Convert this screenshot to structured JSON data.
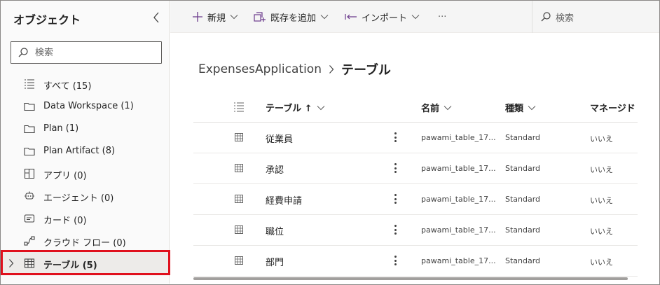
{
  "sidebar": {
    "title": "オブジェクト",
    "search_placeholder": "検索",
    "items": [
      {
        "label": "すべて (15)",
        "icon": "list-icon"
      },
      {
        "label": "Data Workspace (1)",
        "icon": "folder-icon"
      },
      {
        "label": "Plan (1)",
        "icon": "folder-icon"
      },
      {
        "label": "Plan Artifact (8)",
        "icon": "folder-icon"
      },
      {
        "label": "アプリ (0)",
        "icon": "app-icon"
      },
      {
        "label": "エージェント (0)",
        "icon": "agent-icon"
      },
      {
        "label": "カード (0)",
        "icon": "card-icon"
      },
      {
        "label": "クラウド フロー (0)",
        "icon": "flow-icon"
      },
      {
        "label": "テーブル (5)",
        "icon": "table-icon",
        "selected": true
      }
    ]
  },
  "toolbar": {
    "new_label": "新規",
    "add_existing_label": "既存を追加",
    "import_label": "インポート",
    "more_label": "···",
    "search_placeholder": "検索"
  },
  "breadcrumb": {
    "root": "ExpensesApplication",
    "current": "テーブル"
  },
  "table": {
    "columns": {
      "name": "テーブル ↑",
      "system_name": "名前",
      "type": "種類",
      "managed": "マネージド"
    },
    "rows": [
      {
        "name": "従業員",
        "system_name": "pawami_table_17...",
        "type": "Standard",
        "managed": "いいえ"
      },
      {
        "name": "承認",
        "system_name": "pawami_table_17...",
        "type": "Standard",
        "managed": "いいえ"
      },
      {
        "name": "経費申請",
        "system_name": "pawami_table_17...",
        "type": "Standard",
        "managed": "いいえ"
      },
      {
        "name": "職位",
        "system_name": "pawami_table_17...",
        "type": "Standard",
        "managed": "いいえ"
      },
      {
        "name": "部門",
        "system_name": "pawami_table_17...",
        "type": "Standard",
        "managed": "いいえ"
      }
    ]
  }
}
